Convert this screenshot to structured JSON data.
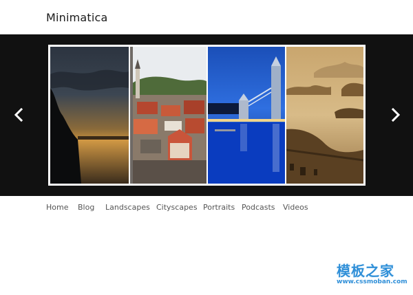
{
  "site": {
    "title": "Minimatica"
  },
  "slider": {
    "prev_icon": "chevron-left-icon",
    "next_icon": "chevron-right-icon",
    "slides": [
      {
        "subject": "sunset-lake"
      },
      {
        "subject": "old-town-rooftops"
      },
      {
        "subject": "tower-bridge-night"
      },
      {
        "subject": "sepia-coastline"
      }
    ]
  },
  "nav": {
    "items": [
      "Home",
      "Blog",
      "Landscapes",
      "Cityscapes",
      "Portraits",
      "Podcasts",
      "Videos"
    ]
  },
  "watermark": {
    "cn": "模板之家",
    "en": "www.cssmoban.com"
  },
  "colors": {
    "slider_bg": "#111111",
    "frame": "#ffffff",
    "nav_text": "#555555",
    "watermark": "#2f8fd8"
  }
}
